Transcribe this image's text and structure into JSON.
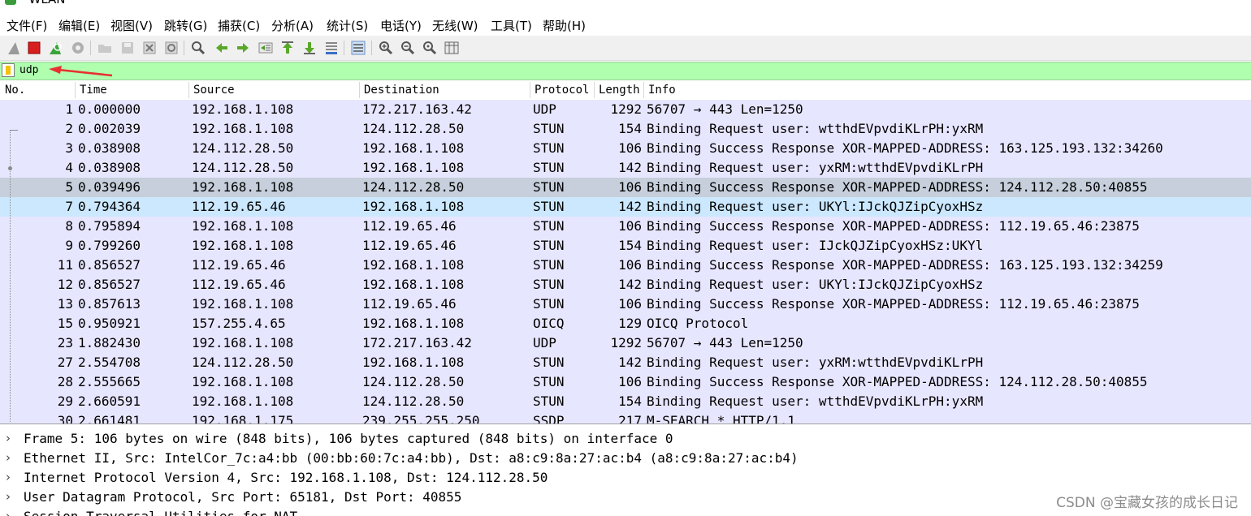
{
  "window": {
    "title": "*WLAN"
  },
  "menu": [
    "文件(F)",
    "编辑(E)",
    "视图(V)",
    "跳转(G)",
    "捕获(C)",
    "分析(A)",
    "统计(S)",
    "电话(Y)",
    "无线(W)",
    "工具(T)",
    "帮助(H)"
  ],
  "toolbar": {
    "icons": [
      "shark-fin-start-icon",
      "stop-capture-icon",
      "restart-capture-icon",
      "capture-options-icon",
      "open-file-icon",
      "save-file-icon",
      "close-file-icon",
      "reload-file-icon",
      "find-packet-icon",
      "go-back-icon",
      "go-forward-icon",
      "go-to-packet-icon",
      "go-first-icon",
      "go-last-icon",
      "autoscroll-icon",
      "colorize-icon",
      "zoom-in-icon",
      "zoom-out-icon",
      "zoom-normal-icon",
      "resize-columns-icon"
    ]
  },
  "filter": {
    "value": "udp",
    "annotation_color": "#e8302f"
  },
  "packet_list": {
    "columns": [
      "No.",
      "Time",
      "Source",
      "Destination",
      "Protocol",
      "Length",
      "Info"
    ],
    "selected_no": "5",
    "rows": [
      {
        "no": "1",
        "time": "0.000000",
        "src": "192.168.1.108",
        "dst": "172.217.163.42",
        "proto": "UDP",
        "len": "1292",
        "info": "56707 → 443 Len=1250"
      },
      {
        "no": "2",
        "time": "0.002039",
        "src": "192.168.1.108",
        "dst": "124.112.28.50",
        "proto": "STUN",
        "len": "154",
        "info": "Binding Request user: wtthdEVpvdiKLrPH:yxRM"
      },
      {
        "no": "3",
        "time": "0.038908",
        "src": "124.112.28.50",
        "dst": "192.168.1.108",
        "proto": "STUN",
        "len": "106",
        "info": "Binding Success Response XOR-MAPPED-ADDRESS: 163.125.193.132:34260"
      },
      {
        "no": "4",
        "time": "0.038908",
        "src": "124.112.28.50",
        "dst": "192.168.1.108",
        "proto": "STUN",
        "len": "142",
        "info": "Binding Request user: yxRM:wtthdEVpvdiKLrPH"
      },
      {
        "no": "5",
        "time": "0.039496",
        "src": "192.168.1.108",
        "dst": "124.112.28.50",
        "proto": "STUN",
        "len": "106",
        "info": "Binding Success Response XOR-MAPPED-ADDRESS: 124.112.28.50:40855"
      },
      {
        "no": "7",
        "time": "0.794364",
        "src": "112.19.65.46",
        "dst": "192.168.1.108",
        "proto": "STUN",
        "len": "142",
        "info": "Binding Request user: UKYl:IJckQJZipCyoxHSz"
      },
      {
        "no": "8",
        "time": "0.795894",
        "src": "192.168.1.108",
        "dst": "112.19.65.46",
        "proto": "STUN",
        "len": "106",
        "info": "Binding Success Response XOR-MAPPED-ADDRESS: 112.19.65.46:23875"
      },
      {
        "no": "9",
        "time": "0.799260",
        "src": "192.168.1.108",
        "dst": "112.19.65.46",
        "proto": "STUN",
        "len": "154",
        "info": "Binding Request user: IJckQJZipCyoxHSz:UKYl"
      },
      {
        "no": "11",
        "time": "0.856527",
        "src": "112.19.65.46",
        "dst": "192.168.1.108",
        "proto": "STUN",
        "len": "106",
        "info": "Binding Success Response XOR-MAPPED-ADDRESS: 163.125.193.132:34259"
      },
      {
        "no": "12",
        "time": "0.856527",
        "src": "112.19.65.46",
        "dst": "192.168.1.108",
        "proto": "STUN",
        "len": "142",
        "info": "Binding Request user: UKYl:IJckQJZipCyoxHSz"
      },
      {
        "no": "13",
        "time": "0.857613",
        "src": "192.168.1.108",
        "dst": "112.19.65.46",
        "proto": "STUN",
        "len": "106",
        "info": "Binding Success Response XOR-MAPPED-ADDRESS: 112.19.65.46:23875"
      },
      {
        "no": "15",
        "time": "0.950921",
        "src": "157.255.4.65",
        "dst": "192.168.1.108",
        "proto": "OICQ",
        "len": "129",
        "info": "OICQ Protocol"
      },
      {
        "no": "23",
        "time": "1.882430",
        "src": "192.168.1.108",
        "dst": "172.217.163.42",
        "proto": "UDP",
        "len": "1292",
        "info": "56707 → 443 Len=1250"
      },
      {
        "no": "27",
        "time": "2.554708",
        "src": "124.112.28.50",
        "dst": "192.168.1.108",
        "proto": "STUN",
        "len": "142",
        "info": "Binding Request user: yxRM:wtthdEVpvdiKLrPH"
      },
      {
        "no": "28",
        "time": "2.555665",
        "src": "192.168.1.108",
        "dst": "124.112.28.50",
        "proto": "STUN",
        "len": "106",
        "info": "Binding Success Response XOR-MAPPED-ADDRESS: 124.112.28.50:40855"
      },
      {
        "no": "29",
        "time": "2.660591",
        "src": "192.168.1.108",
        "dst": "124.112.28.50",
        "proto": "STUN",
        "len": "154",
        "info": "Binding Request user: wtthdEVpvdiKLrPH:yxRM"
      },
      {
        "no": "30",
        "time": "2.661481",
        "src": "192.168.1.175",
        "dst": "239.255.255.250",
        "proto": "SSDP",
        "len": "217",
        "info": "M-SEARCH * HTTP/1.1"
      }
    ]
  },
  "details": [
    "Frame 5: 106 bytes on wire (848 bits), 106 bytes captured (848 bits) on interface 0",
    "Ethernet II, Src: IntelCor_7c:a4:bb (00:bb:60:7c:a4:bb), Dst: a8:c9:8a:27:ac:b4 (a8:c9:8a:27:ac:b4)",
    "Internet Protocol Version 4, Src: 192.168.1.108, Dst: 124.112.28.50",
    "User Datagram Protocol, Src Port: 65181, Dst Port: 40855",
    "Session Traversal Utilities for NAT"
  ],
  "watermark": "CSDN @宝藏女孩的成长日记",
  "colors": {
    "row_udp": "#e7e6ff",
    "row_selected": "#c6cfdb",
    "row_highlight": "#cbe8ff",
    "filter_ok": "#afffaf"
  }
}
